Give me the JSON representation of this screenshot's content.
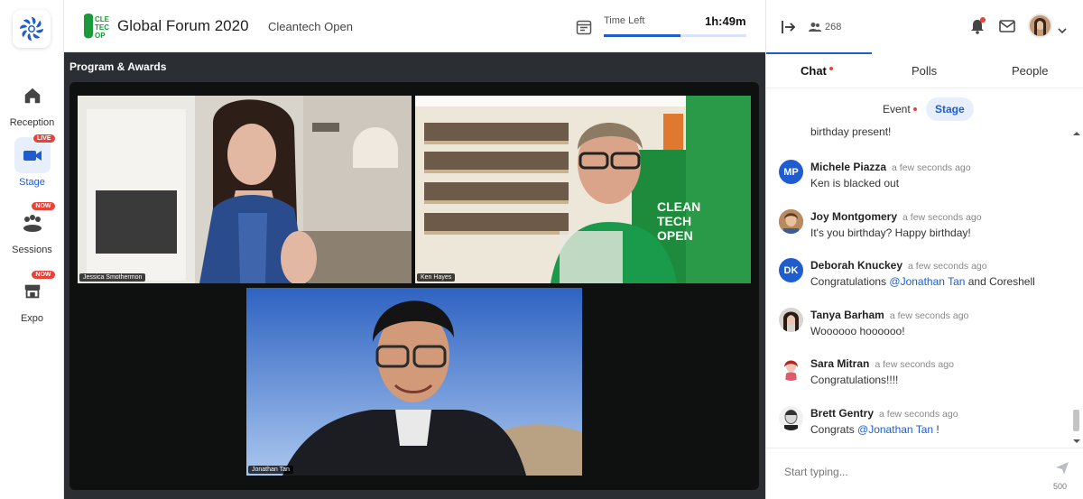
{
  "nav": {
    "items": [
      {
        "label": "Reception",
        "icon": "home-icon"
      },
      {
        "label": "Stage",
        "icon": "stage-icon",
        "badge": "LIVE"
      },
      {
        "label": "Sessions",
        "icon": "sessions-icon",
        "badge": "NOW"
      },
      {
        "label": "Expo",
        "icon": "expo-icon",
        "badge": "NOW"
      }
    ]
  },
  "header": {
    "brand_text": "CLEAN TECH OPEN",
    "event_title": "Global Forum 2020",
    "org_name": "Cleantech Open",
    "time_left_label": "Time Left",
    "time_left_value": "1h:49m",
    "time_left_fraction": 0.54
  },
  "stage": {
    "title": "Program & Awards",
    "videos": [
      {
        "name": "Jessica Smothermon"
      },
      {
        "name": "Ken Hayes"
      },
      {
        "name": "Jonathan Tan"
      }
    ]
  },
  "panel": {
    "attendee_count": "268",
    "tabs": [
      {
        "label": "Chat"
      },
      {
        "label": "Polls"
      },
      {
        "label": "People"
      }
    ],
    "subtabs": [
      {
        "label": "Event"
      },
      {
        "label": "Stage"
      }
    ],
    "cut_off_text": "birthday present!",
    "messages": [
      {
        "initials": "MP",
        "name": "Michele Piazza",
        "time": "a few seconds ago",
        "text": "Ken is blacked out",
        "color": "#1f5dcf"
      },
      {
        "initials": "",
        "name": "Joy Montgomery",
        "time": "a few seconds ago",
        "text": "It's you birthday? Happy birthday!",
        "color": "#a06c46"
      },
      {
        "initials": "DK",
        "name": "Deborah Knuckey",
        "time": "a few seconds ago",
        "text_before": "Congratulations ",
        "mention": "@Jonathan Tan",
        "text_after": " and Coreshell",
        "color": "#1f5dcf"
      },
      {
        "initials": "",
        "name": "Tanya Barham",
        "time": "a few seconds ago",
        "text": "Woooooo hoooooo!",
        "color": "#4a3a33"
      },
      {
        "initials": "",
        "name": "Sara Mitran",
        "time": "a few seconds ago",
        "text": "Congratulations!!!!",
        "color": "#f0d6d6"
      },
      {
        "initials": "",
        "name": "Brett Gentry",
        "time": "a few seconds ago",
        "text_before": "Congrats ",
        "mention": "@Jonathan Tan",
        "text_after": " !",
        "color": "#c9c9c9"
      }
    ],
    "composer_placeholder": "Start typing...",
    "char_count": "500"
  }
}
